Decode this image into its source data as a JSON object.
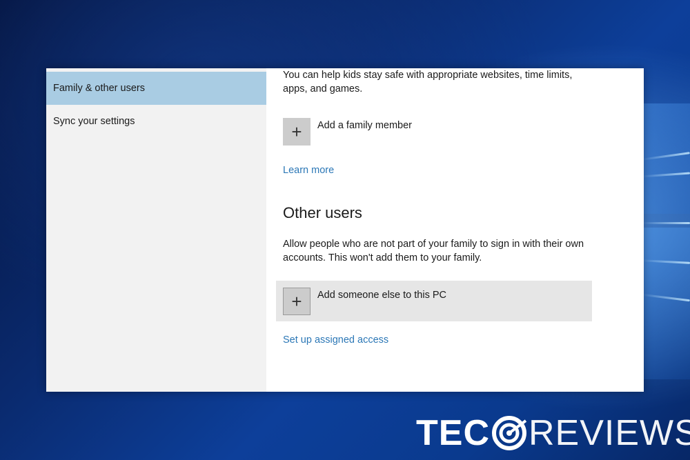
{
  "sidebar": {
    "items": [
      {
        "label": "Family & other users",
        "selected": true
      },
      {
        "label": "Sync your settings",
        "selected": false
      }
    ]
  },
  "family": {
    "description": "You can help kids stay safe with appropriate websites, time limits, apps, and games.",
    "add_label": "Add a family member",
    "learn_more": "Learn more"
  },
  "other_users": {
    "heading": "Other users",
    "description": "Allow people who are not part of your family to sign in with their own accounts. This won't add them to your family.",
    "add_label": "Add someone else to this PC",
    "assigned_access": "Set up assigned access"
  },
  "icons": {
    "add": "plus-icon",
    "watermark_logo": "target-icon"
  },
  "watermark": {
    "part1": "TEC",
    "part2": "REVIEWS"
  },
  "colors": {
    "accent_link": "#2b77b6",
    "selected_nav": "#a9cce3",
    "hover_row": "#e6e6e6"
  }
}
